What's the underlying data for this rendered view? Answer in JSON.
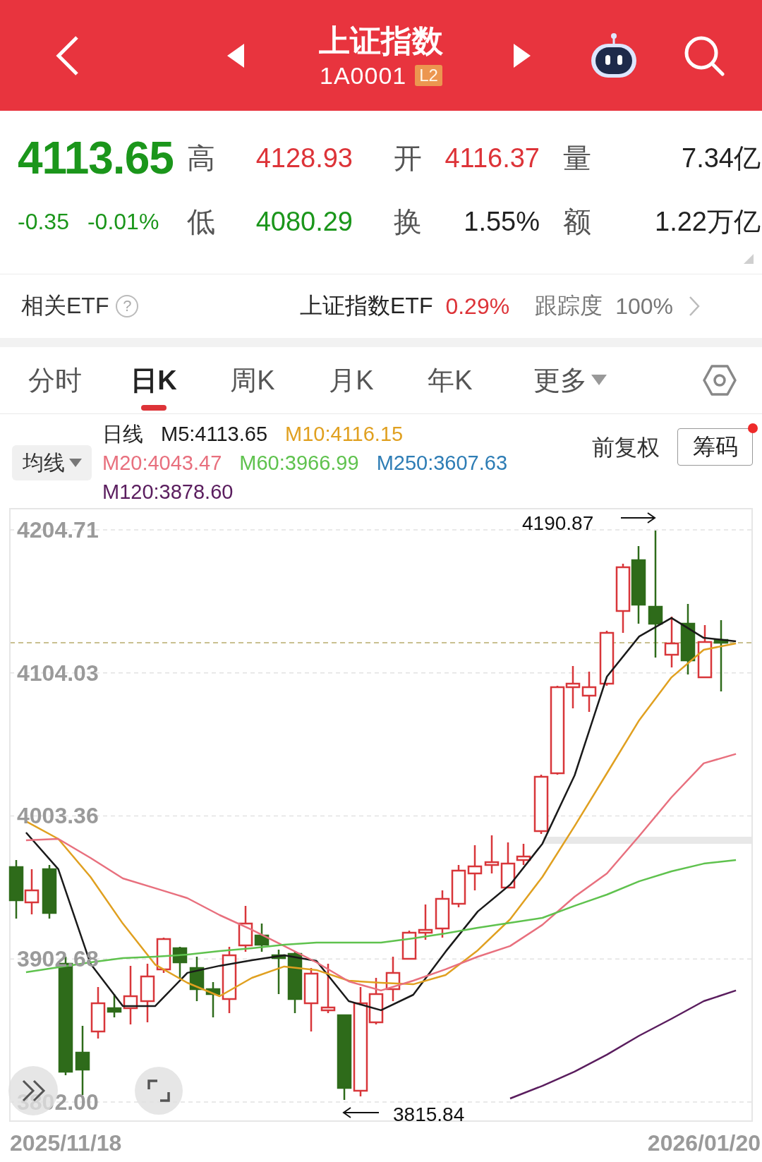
{
  "header": {
    "title": "上证指数",
    "code": "1A0001",
    "badge": "L2"
  },
  "quote": {
    "price": "4113.65",
    "color": "#1b961b",
    "change": "-0.35",
    "change_pct": "-0.01%",
    "stats": [
      {
        "label": "高",
        "value": "4128.93",
        "color": "#dd3338"
      },
      {
        "label": "开",
        "value": "4116.37",
        "color": "#dd3338"
      },
      {
        "label": "量",
        "value": "7.34亿",
        "color": "#222222"
      },
      {
        "label": "低",
        "value": "4080.29",
        "color": "#1b961b"
      },
      {
        "label": "换",
        "value": "1.55%",
        "color": "#222222"
      },
      {
        "label": "额",
        "value": "1.22万亿",
        "color": "#222222"
      }
    ]
  },
  "etf": {
    "label": "相关ETF",
    "help": "?",
    "name": "上证指数ETF",
    "change": "0.29%",
    "tracking_label": "跟踪度",
    "tracking": "100%"
  },
  "tabs": [
    {
      "label": "分时",
      "selected": false,
      "kind": "tab"
    },
    {
      "label": "日K",
      "selected": true,
      "kind": "tab"
    },
    {
      "label": "周K",
      "selected": false,
      "kind": "tab"
    },
    {
      "label": "月K",
      "selected": false,
      "kind": "tab"
    },
    {
      "label": "年K",
      "selected": false,
      "kind": "tab"
    },
    {
      "label": "更多",
      "selected": false,
      "kind": "dropdown"
    }
  ],
  "ma": {
    "selector": "均线",
    "period": "日线",
    "lines": [
      {
        "label": "M5:4113.65",
        "color": "#1a1a1a"
      },
      {
        "label": "M10:4116.15",
        "color": "#e0a020"
      },
      {
        "label": "M20:4043.47",
        "color": "#e8707e"
      },
      {
        "label": "M60:3966.99",
        "color": "#5fc24e"
      },
      {
        "label": "M250:3607.63",
        "color": "#2e7db5"
      },
      {
        "label": "M120:3878.60",
        "color": "#5a1d5e"
      }
    ],
    "adjust": "前复权",
    "chips": {
      "label": "筹码",
      "notify": true
    }
  },
  "chart": {
    "chart_data": {
      "type": "line",
      "grid": true,
      "ylim": [
        3788.6,
        4219.6
      ],
      "yticks": [
        {
          "value": 4204.71,
          "label": "4204.71"
        },
        {
          "value": 4104.03,
          "label": "4104.03"
        },
        {
          "value": 4003.36,
          "label": "4003.36"
        },
        {
          "value": 3902.68,
          "label": "3902.68"
        },
        {
          "value": 3802,
          "label": "3802.00"
        }
      ],
      "series": [
        {
          "color": "#1a1a1a",
          "values": [
            3991.7,
            3965.9,
            3899.3,
            3869.5,
            3869.5,
            3892.9,
            3897.9,
            3901.8,
            3905.3,
            3901.3,
            3873.0,
            3866.6,
            3877.5,
            3907.8,
            3936.1,
            3955.0,
            3983.8,
            4031.9,
            4101.4,
            4129.7,
            4142.7,
            4128.7,
            4126.3
          ]
        },
        {
          "color": "#e0a020",
          "values": [
            3999.6,
            3987.2,
            3960.4,
            3927.6,
            3898.8,
            3885.9,
            3876.5,
            3889.4,
            3897.4,
            3894.9,
            3887.4,
            3885.9,
            3884.9,
            3891.4,
            3908.8,
            3930.6,
            3960.4,
            3996.2,
            4033.4,
            4070.7,
            4100.9,
            4120.3,
            4124.8
          ]
        },
        {
          "color": "#e8707e",
          "values": [
            3986.2,
            3987.2,
            3973.8,
            3959.4,
            3952.5,
            3945.5,
            3933.6,
            3923.2,
            3911.8,
            3900.3,
            3886.9,
            3880.5,
            3887.4,
            3895.4,
            3904.3,
            3911.8,
            3926.7,
            3946.5,
            3962.9,
            3989.2,
            4016.5,
            4040.4,
            4047.0
          ]
        },
        {
          "color": "#5fc24e",
          "values": [
            3893.4,
            3896.9,
            3900.3,
            3903.3,
            3904.3,
            3905.8,
            3908.3,
            3910.3,
            3912.7,
            3914.2,
            3914.2,
            3914.2,
            3917.2,
            3920.7,
            3924.7,
            3928.1,
            3931.6,
            3940.1,
            3948.0,
            3957.4,
            3964.4,
            3969.8,
            3972.3
          ]
        },
        {
          "color": "#5a1d5e",
          "values": [
            null,
            null,
            null,
            null,
            null,
            null,
            null,
            null,
            null,
            null,
            null,
            null,
            null,
            null,
            null,
            3804.5,
            3813.4,
            3823.4,
            3835.3,
            3848.7,
            3860.6,
            3873.0,
            3880.5
          ]
        }
      ]
    },
    "high_label": "4190.87",
    "low_label": "3815.84",
    "start_date": "2025/11/18",
    "end_date": "2026/01/20"
  }
}
